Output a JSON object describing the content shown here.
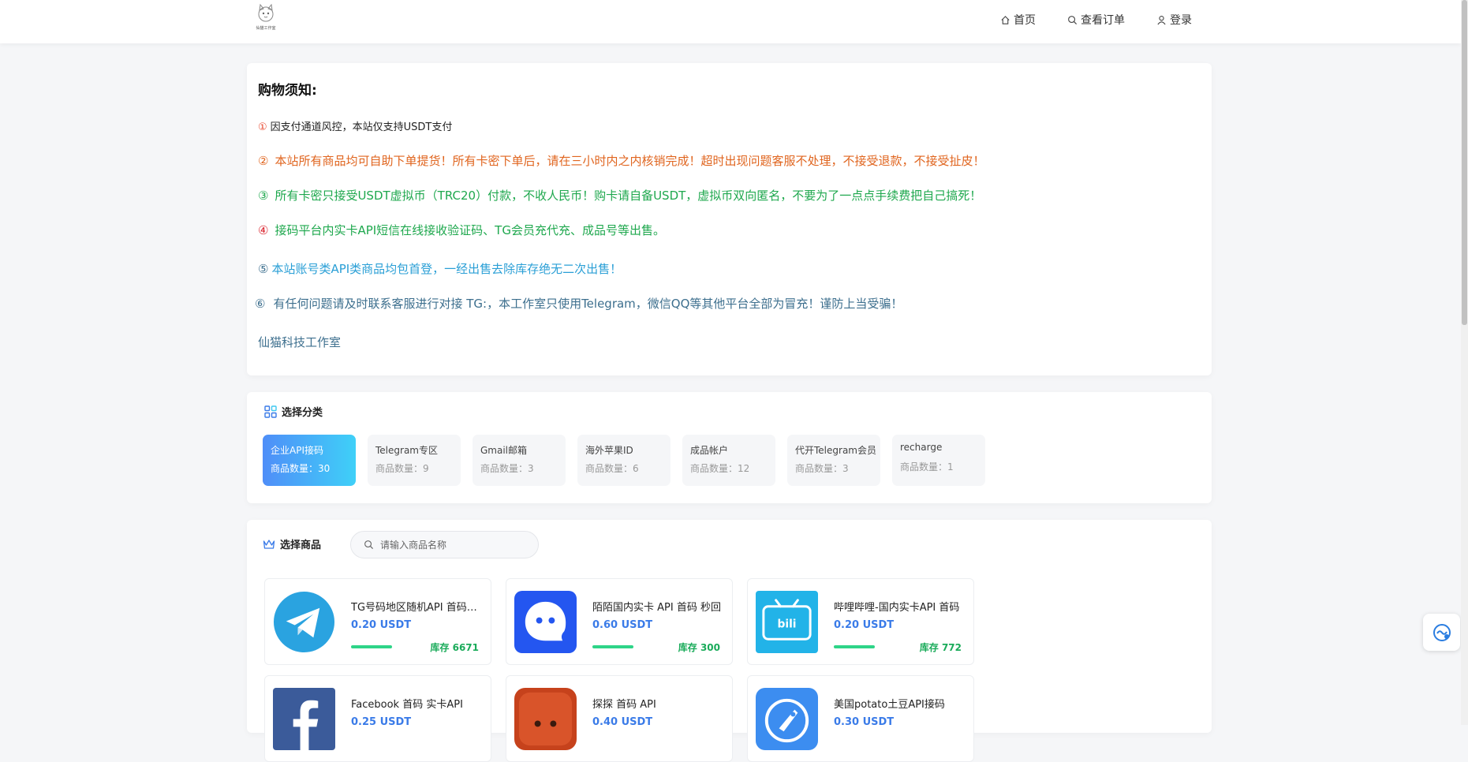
{
  "header": {
    "logo_text": "仙猫工作室",
    "nav": {
      "home": "首页",
      "orders": "查看订单",
      "login": "登录"
    }
  },
  "notice": {
    "title": "购物须知:",
    "lines": [
      {
        "num": "①",
        "text": "因支付通道风控，本站仅支持USDT支付"
      },
      {
        "num": "②",
        "text": "本站所有商品均可自助下单提货！所有卡密下单后，请在三小时内之内核销完成！超时出现问题客服不处理，不接受退款，不接受扯皮！"
      },
      {
        "num": "③",
        "text": "所有卡密只接受USDT虚拟币（TRC20）付款，不收人民币！购卡请自备USDT，虚拟币双向匿名，不要为了一点点手续费把自己搞死！"
      },
      {
        "num": "④",
        "text": "接码平台内实卡API短信在线接收验证码、TG会员充代充、成品号等出售。"
      },
      {
        "num": "⑤",
        "text": "本站账号类API类商品均包首登，一经出售去除库存绝无二次出售！"
      },
      {
        "num": "⑥",
        "text": "有任何问题请及时联系客服进行对接  TG:，本工作室只使用Telegram，微信QQ等其他平台全部为冒充！谨防上当受骗！"
      }
    ],
    "signature": "仙猫科技工作室"
  },
  "categories": {
    "title": "选择分类",
    "items": [
      {
        "name": "企业API接码",
        "count": "商品数量：30"
      },
      {
        "name": "Telegram专区",
        "count": "商品数量：9"
      },
      {
        "name": "Gmail邮箱",
        "count": "商品数量：3"
      },
      {
        "name": "海外苹果ID",
        "count": "商品数量：6"
      },
      {
        "name": "成品帐户",
        "count": "商品数量：12"
      },
      {
        "name": "代开Telegram会员",
        "count": "商品数量：3"
      },
      {
        "name": "recharge",
        "count": "商品数量：1"
      }
    ]
  },
  "products": {
    "title": "选择商品",
    "search_placeholder": "请输入商品名称",
    "items": [
      {
        "name": "TG号码地区随机API 首码实卡",
        "price": "0.20 USDT",
        "stock": "库存 6671",
        "icon": "telegram-logo"
      },
      {
        "name": "陌陌国内实卡 API 首码 秒回",
        "price": "0.60 USDT",
        "stock": "库存 300",
        "icon": "momo-logo"
      },
      {
        "name": "哔哩哔哩-国内实卡API 首码",
        "price": "0.20 USDT",
        "stock": "库存 772",
        "icon": "bilibili-logo"
      },
      {
        "name": "Facebook 首码 实卡API",
        "price": "0.25 USDT",
        "stock": "",
        "icon": "facebook-logo"
      },
      {
        "name": "探探 首码 API",
        "price": "0.40 USDT",
        "stock": "",
        "icon": "tantan-logo"
      },
      {
        "name": "美国potato土豆API接码",
        "price": "0.30 USDT",
        "stock": "",
        "icon": "potato-logo"
      }
    ]
  },
  "colors": {
    "num1": "#e8452c",
    "line2": "#e0651f",
    "line3": "#1fa84e",
    "num4": "#d9232d",
    "line4": "#1fa84e",
    "line5": "#2a9fd6",
    "line6": "#3d6f8e",
    "signature": "#3d6f8e",
    "accent": "#3a7be8",
    "stock": "#1aab5a"
  }
}
